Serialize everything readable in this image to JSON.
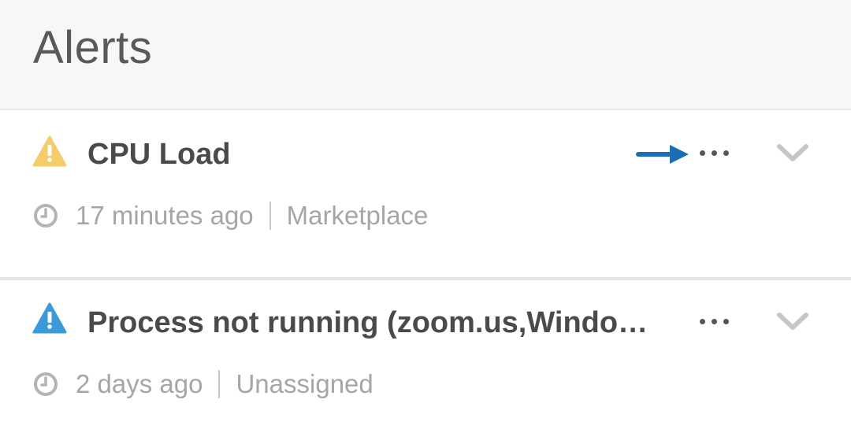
{
  "header": {
    "title": "Alerts"
  },
  "alerts": [
    {
      "title": "CPU Load",
      "severity_icon": "warning-triangle-icon",
      "severity_color": "#f4cc6a",
      "time": "17 minutes ago",
      "assignee": "Marketplace",
      "more_icon": "more-horizontal-icon",
      "expand_icon": "chevron-down-icon"
    },
    {
      "title": "Process not running (zoom.us,Window…",
      "severity_icon": "warning-triangle-icon",
      "severity_color": "#3d9ad8",
      "time": "2 days ago",
      "assignee": "Unassigned",
      "more_icon": "more-horizontal-icon",
      "expand_icon": "chevron-down-icon"
    }
  ],
  "annotation": {
    "arrow_color": "#1a6fb4",
    "points_to": "more-horizontal-icon"
  },
  "colors": {
    "header_bg": "#f7f7f7",
    "title_text": "#4a4a4a",
    "meta_text": "#a6a6a6"
  }
}
